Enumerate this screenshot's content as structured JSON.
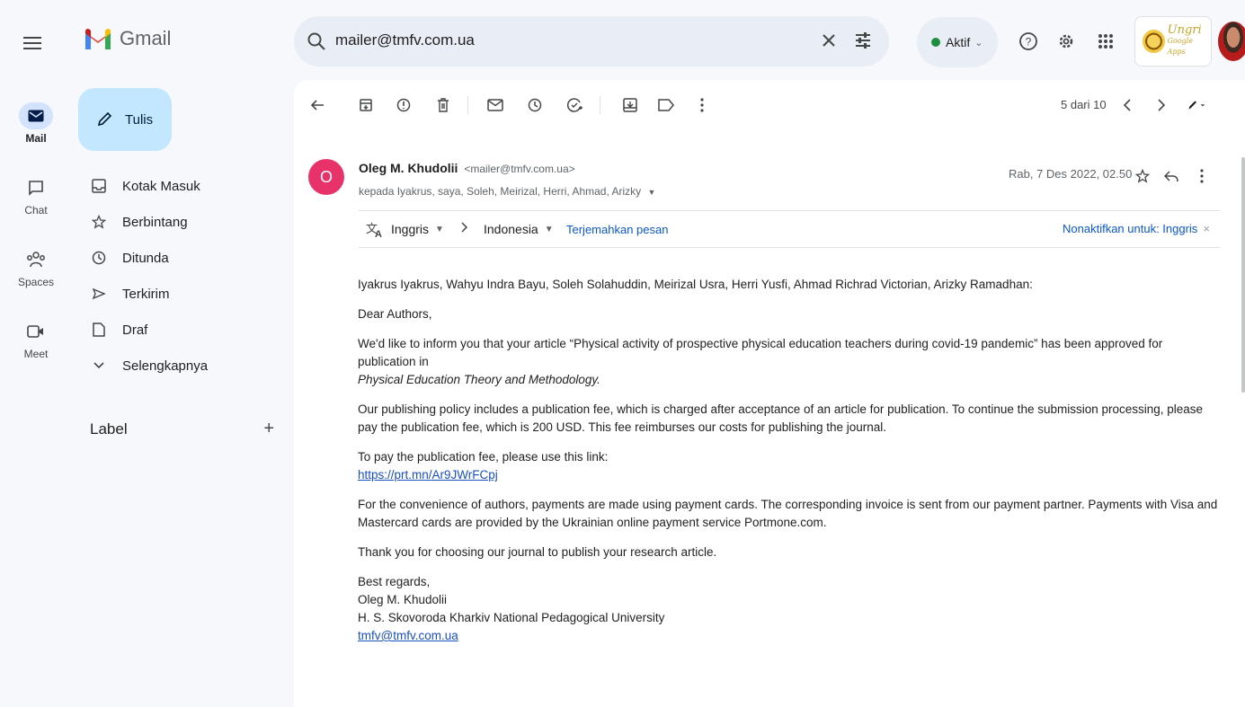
{
  "app": {
    "name": "Gmail",
    "search_value": "mailer@tmfv.com.ua",
    "status_label": "Aktif",
    "org_logo_text": "Ungri",
    "org_logo_subtext": "Google Apps"
  },
  "rail": {
    "items": [
      {
        "label": "Mail",
        "icon": "mail-icon",
        "active": true
      },
      {
        "label": "Chat",
        "icon": "chat-icon"
      },
      {
        "label": "Spaces",
        "icon": "spaces-icon"
      },
      {
        "label": "Meet",
        "icon": "meet-icon"
      }
    ]
  },
  "sidebar": {
    "compose_label": "Tulis",
    "items": [
      {
        "label": "Kotak Masuk",
        "icon": "inbox-icon"
      },
      {
        "label": "Berbintang",
        "icon": "star-icon"
      },
      {
        "label": "Ditunda",
        "icon": "clock-icon"
      },
      {
        "label": "Terkirim",
        "icon": "send-icon"
      },
      {
        "label": "Draf",
        "icon": "draft-icon"
      },
      {
        "label": "Selengkapnya",
        "icon": "chevron-down-icon"
      }
    ],
    "labels_heading": "Label"
  },
  "toolbar": {
    "pager_text": "5 dari 10"
  },
  "message": {
    "avatar_initial": "O",
    "avatar_color": "#e8336a",
    "sender_name": "Oleg M. Khudolii",
    "sender_email": "<mailer@tmfv.com.ua>",
    "recipients": "kepada Iyakrus, saya, Soleh, Meirizal, Herri, Ahmad, Arizky",
    "date": "Rab, 7 Des 2022, 02.50",
    "translate": {
      "from_lang": "Inggris",
      "to_lang": "Indonesia",
      "translate_link": "Terjemahkan pesan",
      "disable_link": "Nonaktifkan untuk: Inggris"
    },
    "body": {
      "addressees": "Iyakrus Iyakrus, Wahyu Indra Bayu, Soleh Solahuddin, Meirizal Usra, Herri Yusfi, Ahmad Richrad Victorian, Arizky Ramadhan:",
      "greeting": "Dear Authors,",
      "p1": "We'd like to inform you that your article “Physical activity of prospective physical education teachers during covid-19 pandemic” has been approved for publication in",
      "p1_journal": "Physical Education Theory and Methodology.",
      "p2": "Our publishing policy includes a publication fee, which is charged after acceptance of an article for publication. To continue the submission processing, please pay the publication fee, which is 200 USD. This fee reimburses our costs for publishing the journal.",
      "p3": "To pay the publication fee, please use this link:",
      "p3_link": "https://prt.mn/Ar9JWrFCpj",
      "p4": "For the convenience of authors, payments are made using payment cards. The corresponding invoice is sent from our payment partner. Payments with Visa and Mastercard cards are provided by the Ukrainian online payment service Portmone.com.",
      "p5": "Thank you for choosing our journal to publish your research article.",
      "sign_regards": "Best regards,",
      "sign_name": "Oleg M. Khudolii",
      "sign_org": "H. S. Skovoroda Kharkiv National Pedagogical University",
      "sign_email": "tmfv@tmfv.com.ua"
    }
  }
}
